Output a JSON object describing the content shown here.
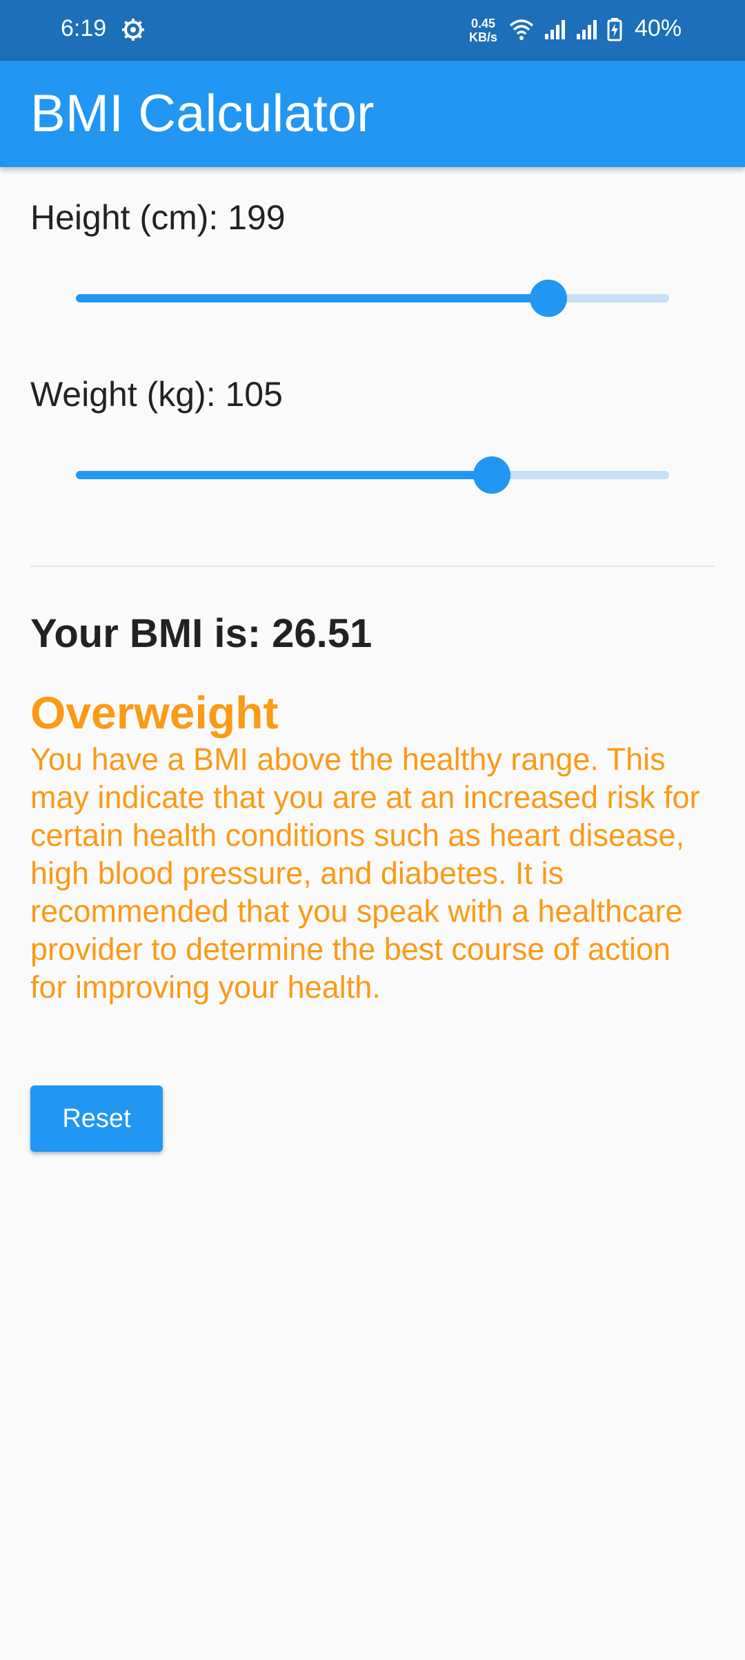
{
  "status_bar": {
    "time": "6:19",
    "net_speed_value": "0.45",
    "net_speed_unit": "KB/s",
    "battery_percent": "40%",
    "icons": [
      "settings-gear-icon",
      "wifi-icon",
      "signal-icon",
      "signal-icon",
      "battery-charging-icon"
    ]
  },
  "app_bar": {
    "title": "BMI Calculator"
  },
  "height": {
    "label": "Height (cm): 199",
    "slider_fraction": 0.797
  },
  "weight": {
    "label": "Weight (kg): 105",
    "slider_fraction": 0.701
  },
  "result": {
    "bmi_text": "Your BMI is: 26.51",
    "category": "Overweight",
    "description": "You have a BMI above the healthy range. This may indicate that you are at an increased risk for certain health conditions such as heart disease, high blood pressure, and diabetes. It is recommended that you speak with a healthcare provider to determine the best course of action for improving your health."
  },
  "actions": {
    "reset_label": "Reset"
  },
  "colors": {
    "primary": "#2196f3",
    "status_bar": "#1c6fb8",
    "warning": "#fb9a15",
    "track_inactive": "#c5dff6"
  }
}
